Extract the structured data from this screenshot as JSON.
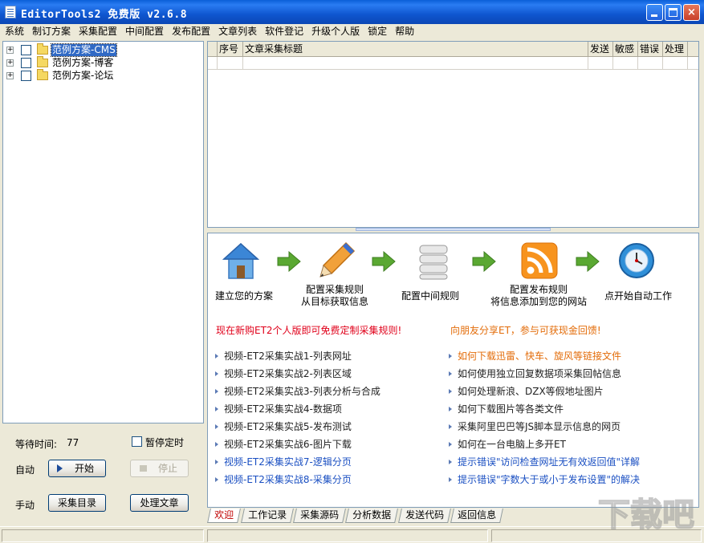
{
  "window": {
    "title": "EditorTools2 免费版 v2.6.8",
    "caption_buttons": {
      "minimize": "minimize-icon",
      "maximize": "maximize-icon",
      "close": "×"
    }
  },
  "menu": [
    "系统",
    "制订方案",
    "采集配置",
    "中间配置",
    "发布配置",
    "文章列表",
    "软件登记",
    "升级个人版",
    "锁定",
    "帮助"
  ],
  "tree": {
    "items": [
      {
        "label": "范例方案-CMS",
        "selected": true,
        "expander": "+"
      },
      {
        "label": "范例方案-博客",
        "selected": false,
        "expander": "+"
      },
      {
        "label": "范例方案-论坛",
        "selected": false,
        "expander": "+"
      }
    ]
  },
  "controls": {
    "wait_label": "等待时间:",
    "wait_value": "77",
    "pause_label": "暂停定时",
    "auto_label": "自动",
    "manual_label": "手动",
    "start_button": "开始",
    "stop_button": "停止",
    "catalog_button": "采集目录",
    "process_button": "处理文章"
  },
  "grid": {
    "columns": [
      "序号",
      "文章采集标题",
      "发送",
      "敏感",
      "错误",
      "处理"
    ]
  },
  "welcome": {
    "steps": [
      {
        "icon": "house-icon",
        "label_line1": "建立您的方案",
        "label_line2": ""
      },
      {
        "icon": "pencil-icon",
        "label_line1": "配置采集规则",
        "label_line2": "从目标获取信息"
      },
      {
        "icon": "database-icon",
        "label_line1": "配置中间规则",
        "label_line2": ""
      },
      {
        "icon": "rss-icon",
        "label_line1": "配置发布规则",
        "label_line2": "将信息添加到您的网站"
      },
      {
        "icon": "clock-icon",
        "label_line1": "点开始自动工作",
        "label_line2": ""
      }
    ],
    "promo_left": "现在新购ET2个人版即可免费定制采集规则!",
    "promo_right": "向朋友分享ET，参与可获现金回馈!",
    "links_left": [
      "视频-ET2采集实战1-列表网址",
      "视频-ET2采集实战2-列表区域",
      "视频-ET2采集实战3-列表分析与合成",
      "视频-ET2采集实战4-数据项",
      "视频-ET2采集实战5-发布测试",
      "视频-ET2采集实战6-图片下载",
      "视频-ET2采集实战7-逻辑分页",
      "视频-ET2采集实战8-采集分页"
    ],
    "links_right": [
      "如何下载迅雷、快车、旋风等链接文件",
      "如何使用独立回复数据项采集回帖信息",
      "如何处理新浪、DZX等假地址图片",
      "如何下载图片等各类文件",
      "采集阿里巴巴等JS脚本显示信息的网页",
      "如何在一台电脑上多开ET",
      "提示错误\"访问检查网址无有效返回值\"详解",
      "提示错误\"字数大于或小于发布设置\"的解决"
    ]
  },
  "tabs": [
    "欢迎",
    "工作记录",
    "采集源码",
    "分析数据",
    "发送代码",
    "返回信息"
  ],
  "watermark": "下载吧",
  "colors": {
    "title_bar": "#0b52d1",
    "selection": "#316ac5",
    "promo_red": "#e0001a",
    "promo_orange": "#e36c09",
    "link_blue": "#1a4fc2",
    "active_tab_text": "#c00000"
  }
}
